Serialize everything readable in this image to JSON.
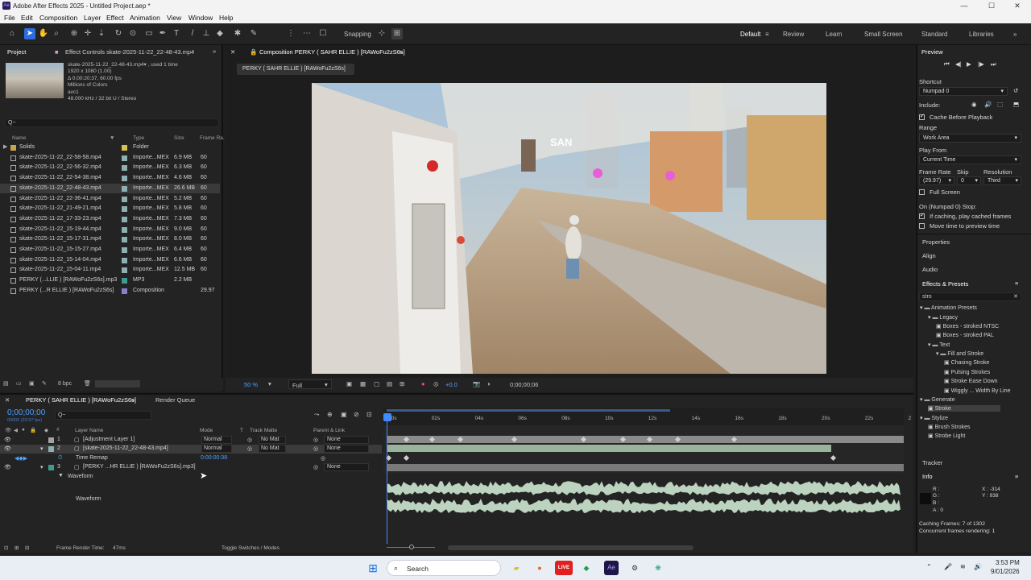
{
  "title_bar": {
    "title": "Adobe After Effects 2025 - Untitled Project.aep *",
    "app_badge": "Ae",
    "minimize": "—",
    "maximize": "☐",
    "close": "✕"
  },
  "menu": [
    "File",
    "Edit",
    "Composition",
    "Layer",
    "Effect",
    "Animation",
    "View",
    "Window",
    "Help"
  ],
  "toolbar": {
    "snapping": "Snapping",
    "workspaces": [
      "Default",
      "Review",
      "Learn",
      "Small Screen",
      "Standard",
      "Libraries"
    ]
  },
  "project": {
    "tab_project": "Project",
    "tab_effect": "Effect Controls skate-2025-11-22_22-48-43.mp4",
    "meta": [
      "skate-2025-11-22_22-48-43.mp4▾ , used 1 time",
      "1920 x 1080 (1.00)",
      "Δ 0;00:20:37, 60.00 fps",
      "Millions of Colors",
      "avc1",
      "48.000 kHz / 32 bit U / Stereo"
    ],
    "search_placeholder": "Q~",
    "columns": {
      "name": "Name",
      "type": "Type",
      "size": "Size",
      "frame": "Frame Ra."
    },
    "items": [
      {
        "name": "Solids",
        "type": "Folder",
        "size": "",
        "fps": ""
      },
      {
        "name": "skate-2025-11-22_22-58-58.mp4",
        "type": "Importe...MEX",
        "size": "6.9 MB",
        "fps": "60"
      },
      {
        "name": "skate-2025-11-22_22-56-32.mp4",
        "type": "Importe...MEX",
        "size": "6.3 MB",
        "fps": "60"
      },
      {
        "name": "skate-2025-11-22_22-54-38.mp4",
        "type": "Importe...MEX",
        "size": "4.6 MB",
        "fps": "60"
      },
      {
        "name": "skate-2025-11-22_22-48-43.mp4",
        "type": "Importe...MEX",
        "size": "26.6 MB",
        "fps": "60"
      },
      {
        "name": "skate-2025-11-22_22-36-41.mp4",
        "type": "Importe...MEX",
        "size": "5.2 MB",
        "fps": "60"
      },
      {
        "name": "skate-2025-11-22_21-49-21.mp4",
        "type": "Importe...MEX",
        "size": "5.8 MB",
        "fps": "60"
      },
      {
        "name": "skate-2025-11-22_17-33-23.mp4",
        "type": "Importe...MEX",
        "size": "7.3 MB",
        "fps": "60"
      },
      {
        "name": "skate-2025-11-22_15-19-44.mp4",
        "type": "Importe...MEX",
        "size": "9.0 MB",
        "fps": "60"
      },
      {
        "name": "skate-2025-11-22_15-17-31.mp4",
        "type": "Importe...MEX",
        "size": "8.0 MB",
        "fps": "60"
      },
      {
        "name": "skate-2025-11-22_15-15-27.mp4",
        "type": "Importe...MEX",
        "size": "6.4 MB",
        "fps": "60"
      },
      {
        "name": "skate-2025-11-22_15-14-04.mp4",
        "type": "Importe...MEX",
        "size": "6.6 MB",
        "fps": "60"
      },
      {
        "name": "skate-2025-11-22_15-04-11.mp4",
        "type": "Importe...MEX",
        "size": "12.5 MB",
        "fps": "60"
      },
      {
        "name": "PERKY (...LLIE ) [RAWoFu2zS6s].mp3",
        "type": "MP3",
        "size": "2.2 MB",
        "fps": ""
      },
      {
        "name": "PERKY (...R ELLIE ) [RAWoFu2zS6s]",
        "type": "Composition",
        "size": "",
        "fps": "29.97"
      }
    ],
    "bpc": "8 bpc"
  },
  "comp": {
    "tab": "Composition PERKY ( SAHR ELLIE ) [RAWoFu2zS6s]",
    "breadcrumb": "PERKY ( SAHR ELLIE ) [RAWoFu2zS6s]",
    "zoom": "50 %",
    "resolution": "Full",
    "exposure": "+0.0",
    "timecode": "0;00;00;06",
    "sign": "SAN"
  },
  "preview": {
    "title": "Preview",
    "shortcut_label": "Shortcut",
    "shortcut": "Numpad 0",
    "include_label": "Include:",
    "cache": "Cache Before Playback",
    "range_label": "Range",
    "range": "Work Area",
    "playfrom_label": "Play From",
    "playfrom": "Current Time",
    "framerate_label": "Frame Rate",
    "skip_label": "Skip",
    "resolution_label": "Resolution",
    "framerate": "(29.97)",
    "skip": "0",
    "resolution": "Third",
    "fullscreen": "Full Screen",
    "stop_label": "On (Numpad 0) Stop:",
    "if_caching": "If caching, play cached frames",
    "move_time": "Move time to preview time"
  },
  "side_panels": {
    "properties": "Properties",
    "align": "Align",
    "audio": "Audio",
    "effects": "Effects & Presets",
    "search": "stro",
    "tree": [
      "Animation Presets",
      "Legacy",
      "Boxes - stroked NTSC",
      "Boxes - stroked PAL",
      "Text",
      "Fill and Stroke",
      "Chasing Stroke",
      "Pulsing Strokes",
      "Stroke Ease Down",
      "Wiggly ... Width By Line",
      "Generate",
      "Stroke",
      "Stylize",
      "Brush Strokes",
      "Strobe Light"
    ],
    "tracker": "Tracker",
    "info": "Info",
    "info_r": "R :",
    "info_g": "G :",
    "info_b": "B :",
    "info_a": "A : 0",
    "info_x": "X : -314",
    "info_y": "Y : 938",
    "caching": "Caching Frames: 7 of 1302",
    "concurrent": "Concurrent frames rendering: 1"
  },
  "timeline": {
    "tab": "PERKY ( SAHR ELLIE ) [RAWoFu2zS6s]",
    "render_queue": "Render Queue",
    "timecode": "0;00;00;00",
    "timecode_sub": "00000 (29.97 fps)",
    "headers": {
      "layer": "Layer Name",
      "mode": "Mode",
      "t": "T",
      "matte": "Track Matte",
      "parent": "Parent & Link"
    },
    "layers": [
      {
        "num": "1",
        "name": "[Adjustment Layer 1]",
        "mode": "Normal",
        "matte": "No Mat",
        "parent": "None"
      },
      {
        "num": "2",
        "name": "[skate-2025-11-22_22-48-43.mp4]",
        "mode": "Normal",
        "matte": "No Mat",
        "parent": "None"
      },
      {
        "num": "",
        "name": "Time Remap",
        "mode": "0:00:00:38",
        "matte": "",
        "parent": ""
      },
      {
        "num": "3",
        "name": "[PERKY ...HR ELLIE ) [RAWoFu2zS6s].mp3]",
        "mode": "",
        "matte": "",
        "parent": "None"
      }
    ],
    "waveform_group": "Waveform",
    "waveform_label": "Waveform",
    "ticks": [
      "00s",
      "02s",
      "04s",
      "06s",
      "08s",
      "10s",
      "12s",
      "14s",
      "16s",
      "18s",
      "20s",
      "22s",
      "2"
    ],
    "frame_render": "Frame Render Time:",
    "frame_render_val": "47ms",
    "toggle": "Toggle Switches / Modes"
  },
  "taskbar": {
    "search": "Search",
    "time": "3:53 PM",
    "date": "9/01/2026",
    "live": "LIVE"
  }
}
